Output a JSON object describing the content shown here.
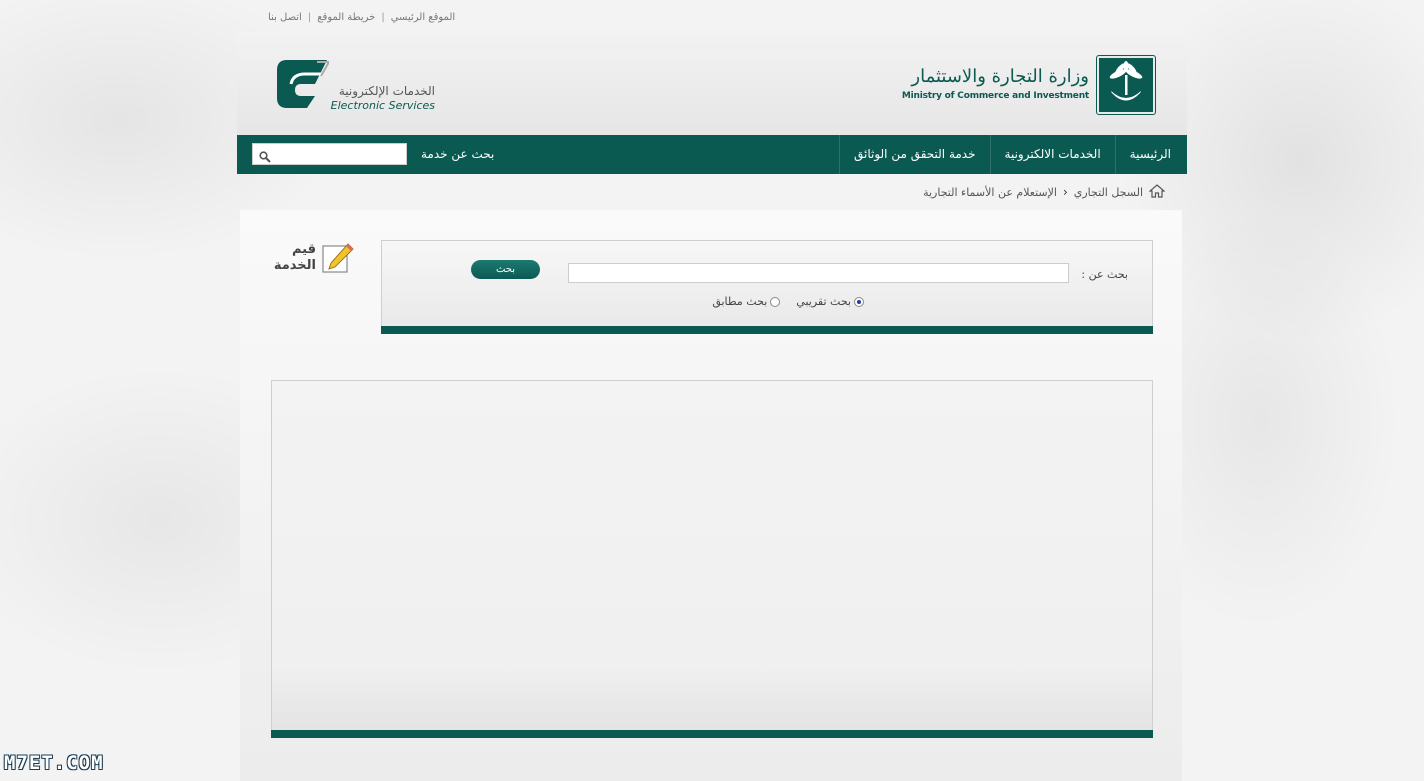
{
  "top_links": {
    "main_site": "الموقع الرئيسي",
    "site_map": "خريطة الموقع",
    "contact": "اتصل بنا",
    "separator": "|"
  },
  "header": {
    "ministry_ar": "وزارة التجارة والاستثمار",
    "ministry_en": "Ministry of Commerce and Investment",
    "es_ar": "الخدمات الإلكترونية",
    "es_en": "Electronic Services"
  },
  "nav": {
    "items": [
      "الرئيسية",
      "الخدمات الالكترونية",
      "خدمة التحقق من الوثائق"
    ],
    "search_label": "بحث عن خدمة",
    "search_placeholder": ""
  },
  "breadcrumb": {
    "items": [
      "السجل التجاري",
      "الإستعلام عن الأسماء التجارية"
    ]
  },
  "rating": {
    "label": "قيم الخدمة"
  },
  "search_panel": {
    "label": "بحث عن :",
    "input_value": "",
    "button_label": "بحث",
    "radio_options": [
      "بحث تقريبي",
      "بحث مطابق"
    ],
    "selected_index": 0
  },
  "watermark": "M7ET.COM",
  "colors": {
    "primary": "#0b5a52",
    "background": "#f4f4f4"
  }
}
